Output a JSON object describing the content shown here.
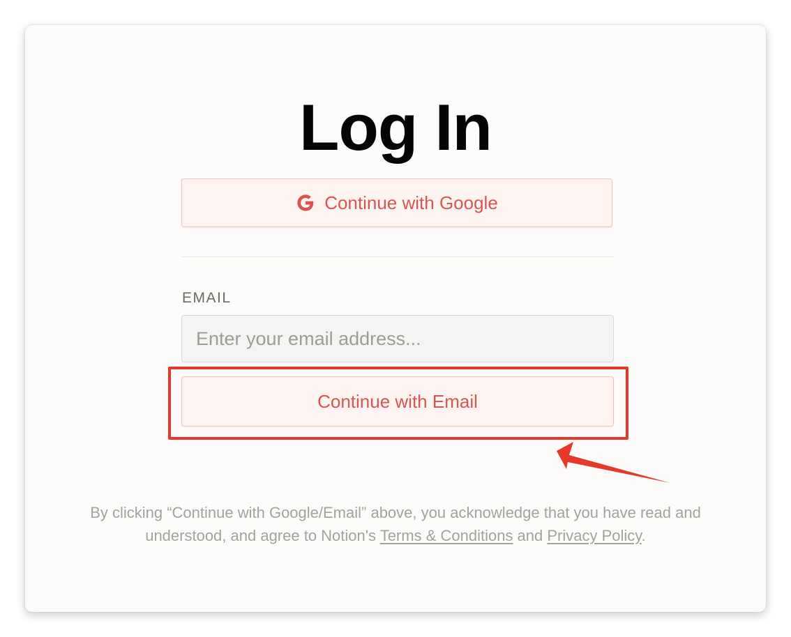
{
  "login": {
    "title": "Log In",
    "google_button_label": "Continue with Google",
    "email_label": "EMAIL",
    "email_value": "",
    "email_placeholder": "Enter your email address...",
    "email_button_label": "Continue with Email",
    "legal": {
      "text_before": "By clicking “Continue with Google/Email” above, you acknowledge that you have read and understood, and agree to Notion's ",
      "terms_link": "Terms & Conditions",
      "text_middle": " and ",
      "privacy_link": "Privacy Policy",
      "text_after": "."
    }
  },
  "annotation": {
    "highlight_color": "#e53a2b",
    "arrow_color": "#e53a2b"
  },
  "colors": {
    "accent": "#d9554f",
    "button_bg": "#fdf4f2",
    "card_bg": "#fdfcfa"
  },
  "icons": {
    "google": "google-g-icon"
  }
}
